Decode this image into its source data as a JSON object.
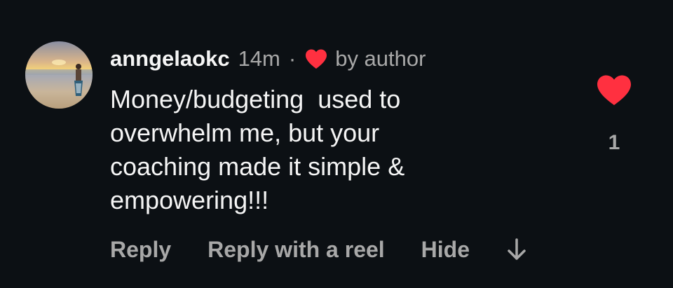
{
  "comment": {
    "username": "anngelaokc",
    "timestamp": "14m",
    "separator": "·",
    "liked_by_author_icon": "heart-icon",
    "liked_by_label": "by author",
    "text": "Money/budgeting  used to\noverwhelm me, but your\ncoaching made it simple &\nempowering!!!",
    "like_icon": "heart-icon",
    "like_count": "1",
    "actions": {
      "reply": "Reply",
      "reply_with_reel": "Reply with a reel",
      "hide": "Hide",
      "more_icon": "down-arrow-icon"
    }
  },
  "colors": {
    "background": "#0c1014",
    "primary_text": "#f5f5f5",
    "secondary_text": "#a8a8a8",
    "heart": "#ff3040"
  }
}
